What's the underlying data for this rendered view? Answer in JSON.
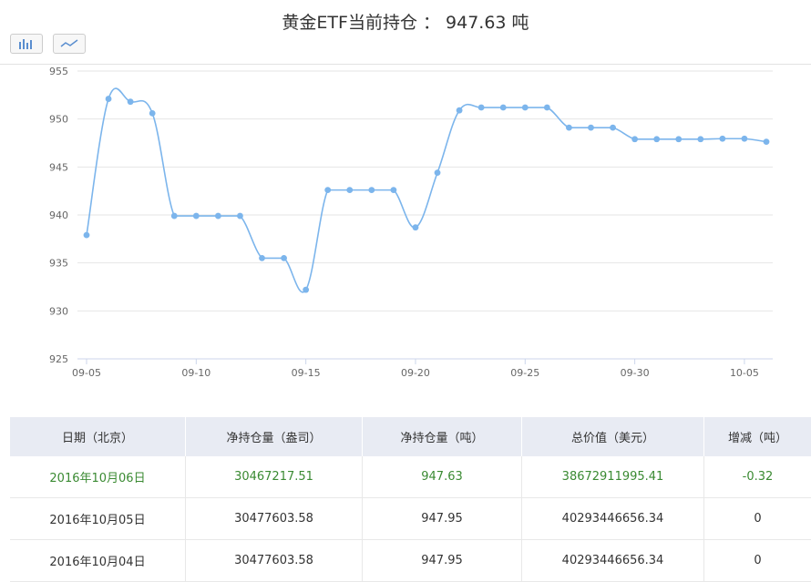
{
  "header": {
    "title": "黄金ETF当前持仓 ： 947.63 吨"
  },
  "toolbar": {
    "bar_icon": "bar-chart-icon",
    "line_icon": "line-chart-icon"
  },
  "colors": {
    "line": "#7cb5ec",
    "grid": "#e6e6e6",
    "header_bg": "#e8ebf3",
    "highlight_text": "#3a8a32"
  },
  "chart_data": {
    "type": "line",
    "x": [
      "09-05",
      "09-06",
      "09-07",
      "09-08",
      "09-09",
      "09-10",
      "09-11",
      "09-12",
      "09-13",
      "09-14",
      "09-15",
      "09-16",
      "09-17",
      "09-18",
      "09-19",
      "09-20",
      "09-21",
      "09-22",
      "09-23",
      "09-24",
      "09-25",
      "09-26",
      "09-27",
      "09-28",
      "09-29",
      "09-30",
      "10-01",
      "10-02",
      "10-03",
      "10-04",
      "10-05",
      "10-06"
    ],
    "values": [
      937.9,
      952.1,
      951.8,
      950.6,
      939.9,
      939.9,
      939.9,
      939.9,
      935.5,
      935.5,
      932.2,
      942.6,
      942.6,
      942.6,
      942.6,
      938.7,
      944.4,
      950.9,
      951.2,
      951.2,
      951.2,
      951.2,
      949.1,
      949.1,
      949.1,
      947.9,
      947.9,
      947.9,
      947.9,
      947.95,
      947.95,
      947.63
    ],
    "xticks": [
      "09-05",
      "09-10",
      "09-15",
      "09-20",
      "09-25",
      "09-30",
      "10-05"
    ],
    "yticks": [
      925,
      930,
      935,
      940,
      945,
      950,
      955
    ],
    "ylim": [
      925,
      955
    ],
    "grid": true
  },
  "table": {
    "headers": [
      "日期（北京）",
      "净持仓量（盎司）",
      "净持仓量（吨）",
      "总价值（美元）",
      "增减（吨）"
    ],
    "rows": [
      [
        "2016年10月06日",
        "30467217.51",
        "947.63",
        "38672911995.41",
        "-0.32"
      ],
      [
        "2016年10月05日",
        "30477603.58",
        "947.95",
        "40293446656.34",
        "0"
      ],
      [
        "2016年10月04日",
        "30477603.58",
        "947.95",
        "40293446656.34",
        "0"
      ]
    ]
  }
}
